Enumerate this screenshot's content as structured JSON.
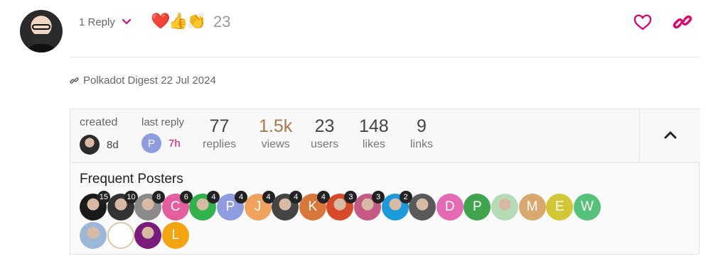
{
  "post": {
    "replies_label": "1 Reply",
    "reactions": [
      "❤️",
      "👍",
      "👏"
    ],
    "reaction_count": "23",
    "icons": {
      "chevron": "chevron-down-icon",
      "heart": "heart-icon",
      "link": "link-icon"
    }
  },
  "digest": {
    "text": "Polkadot Digest 22 Jul 2024",
    "icon": "link-icon"
  },
  "topic_map": {
    "created_label": "created",
    "created_time": "8d",
    "last_reply_label": "last reply",
    "last_reply_initial": "P",
    "last_reply_time": "7h",
    "stats": [
      {
        "value": "77",
        "label": "replies"
      },
      {
        "value": "1.5k",
        "label": "views"
      },
      {
        "value": "23",
        "label": "users"
      },
      {
        "value": "148",
        "label": "likes"
      },
      {
        "value": "9",
        "label": "links"
      }
    ],
    "frequent_title": "Frequent Posters",
    "posters": [
      {
        "initial": "",
        "count": "15",
        "color": "#1a1a1a"
      },
      {
        "initial": "",
        "count": "10",
        "color": "#333333"
      },
      {
        "initial": "",
        "count": "8",
        "color": "#8a8a8a"
      },
      {
        "initial": "C",
        "count": "6",
        "color": "#e45f9e"
      },
      {
        "initial": "",
        "count": "4",
        "color": "#2fb34a"
      },
      {
        "initial": "P",
        "count": "4",
        "color": "#8f9de0"
      },
      {
        "initial": "J",
        "count": "4",
        "color": "#f0a35d"
      },
      {
        "initial": "",
        "count": "4",
        "color": "#444444"
      },
      {
        "initial": "K",
        "count": "4",
        "color": "#d9773b"
      },
      {
        "initial": "",
        "count": "3",
        "color": "#d84b2a"
      },
      {
        "initial": "",
        "count": "3",
        "color": "#c55b85"
      },
      {
        "initial": "",
        "count": "2",
        "color": "#1b9bd9"
      },
      {
        "initial": "",
        "count": "",
        "color": "#5a5a5a"
      },
      {
        "initial": "D",
        "count": "",
        "color": "#e36ab3"
      },
      {
        "initial": "P",
        "count": "",
        "color": "#3fa44d"
      },
      {
        "initial": "",
        "count": "",
        "color": "#b4dbb5"
      },
      {
        "initial": "M",
        "count": "",
        "color": "#d9a86e"
      },
      {
        "initial": "E",
        "count": "",
        "color": "#d2c737"
      },
      {
        "initial": "W",
        "count": "",
        "color": "#56c17a"
      },
      {
        "initial": "",
        "count": "",
        "color": "#9bb8d8"
      },
      {
        "initial": "",
        "count": "",
        "color": "#ffffff"
      },
      {
        "initial": "",
        "count": "",
        "color": "#7a1a7a"
      },
      {
        "initial": "L",
        "count": "",
        "color": "#f2a50f"
      }
    ]
  },
  "colors": {
    "accent": "#d80b6c",
    "views": "#a8784d",
    "muted": "#666666"
  }
}
